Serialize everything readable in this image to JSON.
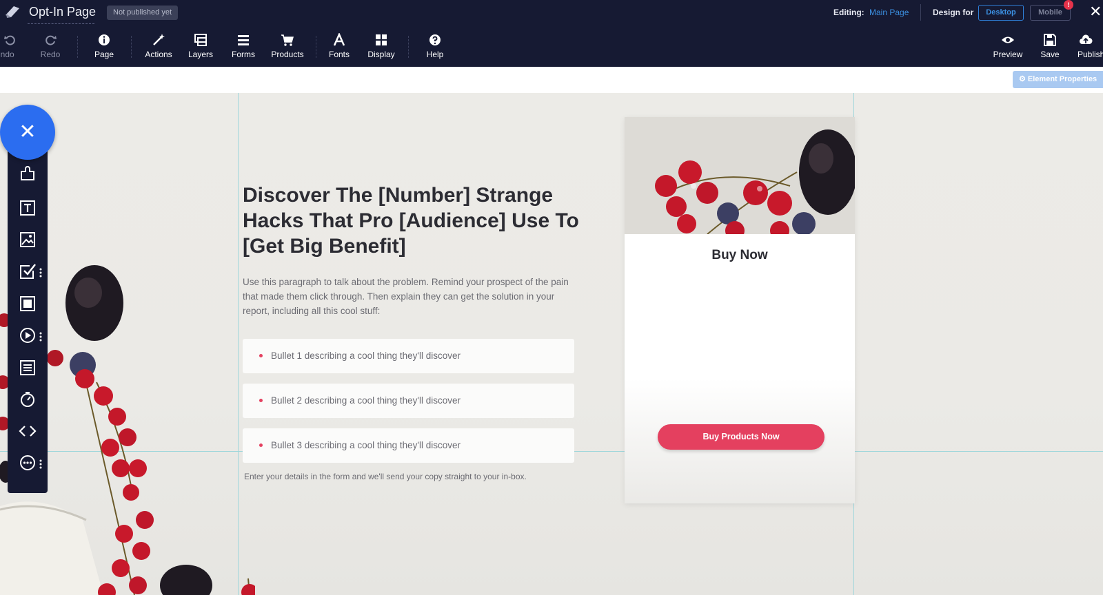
{
  "app": {
    "title": "Opt-In Page",
    "publish_status": "Not published yet"
  },
  "editing": {
    "label": "Editing:",
    "value": "Main Page"
  },
  "design_for": {
    "label": "Design for",
    "options": [
      "Desktop",
      "Mobile"
    ],
    "selected": "Desktop",
    "notification_count": "!"
  },
  "toolbar": {
    "undo": "Undo",
    "redo": "Redo",
    "page": "Page",
    "actions": "Actions",
    "layers": "Layers",
    "forms": "Forms",
    "products": "Products",
    "fonts": "Fonts",
    "display": "Display",
    "help": "Help",
    "preview": "Preview",
    "save": "Save",
    "publish": "Publish"
  },
  "element_properties": "⚙ Element Properties",
  "side_tools": [
    "puzzle-icon",
    "text-icon",
    "image-icon",
    "checkbox-icon",
    "box-icon",
    "video-icon",
    "form-icon",
    "timer-icon",
    "code-icon",
    "more-icon"
  ],
  "content": {
    "headline": "Discover The [Number] Strange Hacks That Pro [Audience] Use To [Get Big Benefit]",
    "paragraph": "Use this paragraph to talk about the problem.  Remind your prospect of the pain that made them click through.  Then explain they can get the solution in your report, including all this cool stuff:",
    "bullets": [
      "Bullet 1 describing a cool thing they'll discover",
      "Bullet 2 describing a cool thing they'll discover",
      "Bullet 3 describing a cool thing they'll discover"
    ],
    "note": "Enter your details in the form and we'll send your copy straight to your in-box."
  },
  "buy_card": {
    "title": "Buy Now",
    "button": "Buy Products Now"
  },
  "colors": {
    "topbar": "#161a33",
    "accent_blue": "#2b6df0",
    "cta_pink": "#e4405f"
  }
}
